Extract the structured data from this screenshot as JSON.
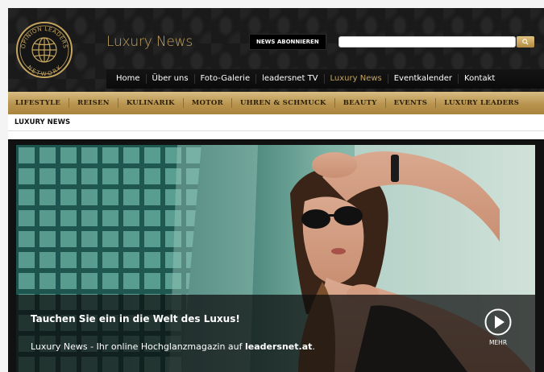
{
  "site": {
    "logo_text_top": "OPINION LEADERS",
    "logo_text_bottom": "NETWORK",
    "section_title": "Luxury News"
  },
  "header": {
    "subscribe_label": "NEWS ABONNIEREN",
    "search_placeholder": "",
    "search_icon": "search-icon"
  },
  "main_nav": {
    "items": [
      {
        "label": "Home"
      },
      {
        "label": "Über uns"
      },
      {
        "label": "Foto-Galerie"
      },
      {
        "label": "leadersnet TV"
      },
      {
        "label": "Luxury News",
        "active": true
      },
      {
        "label": "Eventkalender"
      },
      {
        "label": "Kontakt"
      }
    ]
  },
  "category_nav": {
    "items": [
      {
        "label": "LIFESTYLE"
      },
      {
        "label": "REISEN"
      },
      {
        "label": "KULINARIK"
      },
      {
        "label": "MOTOR"
      },
      {
        "label": "UHREN & SCHMUCK"
      },
      {
        "label": "BEAUTY"
      },
      {
        "label": "EVENTS"
      },
      {
        "label": "LUXURY LEADERS"
      }
    ]
  },
  "breadcrumb": "LUXURY NEWS",
  "hero": {
    "title": "Tauchen Sie ein in die Welt des Luxus!",
    "text_prefix": "Luxury News - Ihr online Hochglanzmagazin auf ",
    "text_link": "leadersnet.at",
    "text_suffix": ".",
    "more_label": "MEHR",
    "more_icon": "play-icon"
  },
  "colors": {
    "gold": "#c4a45f",
    "category_bar": "#c1a05c",
    "header_bg": "#1a1a1a"
  }
}
